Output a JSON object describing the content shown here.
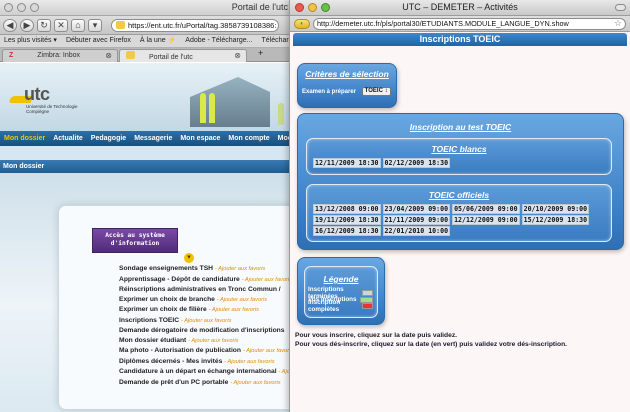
{
  "back_window": {
    "title": "Portail de l'utc",
    "url": "https://ent.utc.fr/uPortal/tag.3858739108386:",
    "bookmarks": [
      "Les plus visités ▾",
      "Débuter avec Firefox",
      "À la une ⚡",
      "Adobe - Télécharge...",
      "Télécharger Macrom..."
    ],
    "tabs": [
      {
        "label": "Zimbra: Inbox"
      },
      {
        "label": "Portail de l'utc"
      }
    ],
    "tab_new": "+",
    "logo": {
      "wordmark": "utc",
      "subtitle": "Université de Technologie Compiègne"
    },
    "nav": [
      "Mon dossier",
      "Actualite",
      "Pedagogie",
      "Messagerie",
      "Mon espace",
      "Mon compte",
      "Moodle"
    ],
    "section_title": "Mon dossier",
    "acces_box": "Accès au système d'information",
    "favorite_label": "- Ajouter aux favoris",
    "links": [
      "Sondage enseignements TSH",
      "Apprentissage - Dépôt de candidature",
      "Réinscriptions administratives en Tronc Commun /",
      "Exprimer un choix de branche",
      "Exprimer un choix de filière",
      "Inscriptions TOEIC",
      "Demande dérogatoire de modification d'inscriptions",
      "Mon dossier étudiant",
      "Ma photo - Autorisation de publication",
      "Diplômes décernés - Mes invités",
      "Candidature à un départ en échange international",
      "Demande de prêt d'un PC portable"
    ],
    "links_with_fav": [
      true,
      true,
      false,
      true,
      true,
      true,
      false,
      true,
      true,
      true,
      true,
      true
    ]
  },
  "front_window": {
    "title": "UTC – DEMETER – Activités",
    "url": "http://demeter.utc.fr/pls/portal30/ETUDIANTS.MODULE_LANGUE_DYN.show",
    "header": "Inscriptions TOEIC",
    "criteres": {
      "title": "Critères de sélection",
      "label": "Examen à préparer",
      "selected": "TOEIC ↕"
    },
    "inscription": {
      "title": "Inscription au test TOEIC",
      "blancs_title": "TOEIC blancs",
      "blancs": [
        "12/11/2009 18:30",
        "02/12/2009 18:30"
      ],
      "officiels_title": "TOEIC officiels",
      "officiels": [
        [
          "13/12/2008 09:00",
          "23/04/2009 09:00",
          "05/06/2009 09:00",
          "20/10/2009 09:00"
        ],
        [
          "19/11/2009 18:30",
          "21/11/2009 09:00",
          "12/12/2009 09:00",
          "15/12/2009 18:30"
        ],
        [
          "16/12/2009 18:30",
          "22/01/2010 10:00"
        ]
      ]
    },
    "legende": {
      "title": "Légende",
      "items": [
        {
          "label": "Inscriptions terminées",
          "color": "#d3d3d3"
        },
        {
          "label": "Vos inscriptions",
          "color": "#9ee08a"
        },
        {
          "label": "Inscription complètes",
          "color": "#e8323a"
        }
      ]
    },
    "instructions": [
      "Pour vous inscrire, cliquez sur la date puis validez.",
      "Pour vous dés-inscrire, cliquez sur la date (en vert) puis validez votre dés-inscription."
    ]
  }
}
